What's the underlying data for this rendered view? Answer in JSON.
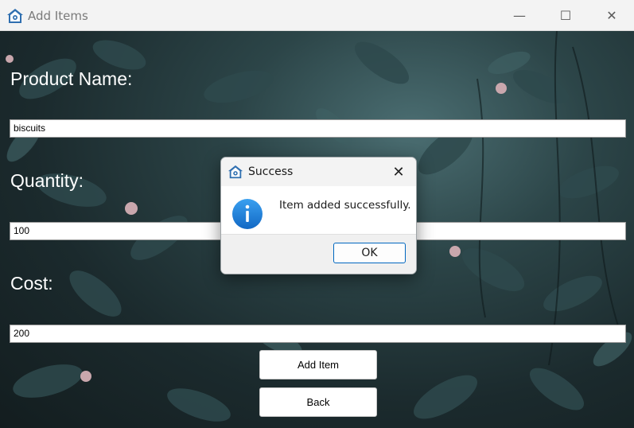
{
  "window": {
    "title": "Add Items",
    "controls": {
      "minimize": "—",
      "maximize": "☐",
      "close": "✕"
    }
  },
  "form": {
    "product_label": "Product Name:",
    "product_value": "biscuits",
    "quantity_label": "Quantity:",
    "quantity_value": "100",
    "cost_label": "Cost:",
    "cost_value": "200",
    "add_button": "Add Item",
    "back_button": "Back"
  },
  "dialog": {
    "title": "Success",
    "message": "Item added successfully.",
    "ok_button": "OK",
    "close_glyph": "✕",
    "icon": "info-icon"
  },
  "colors": {
    "accent": "#0067c0",
    "info_icon": "#1e88e5",
    "app_icon": "#2f6fb0"
  }
}
